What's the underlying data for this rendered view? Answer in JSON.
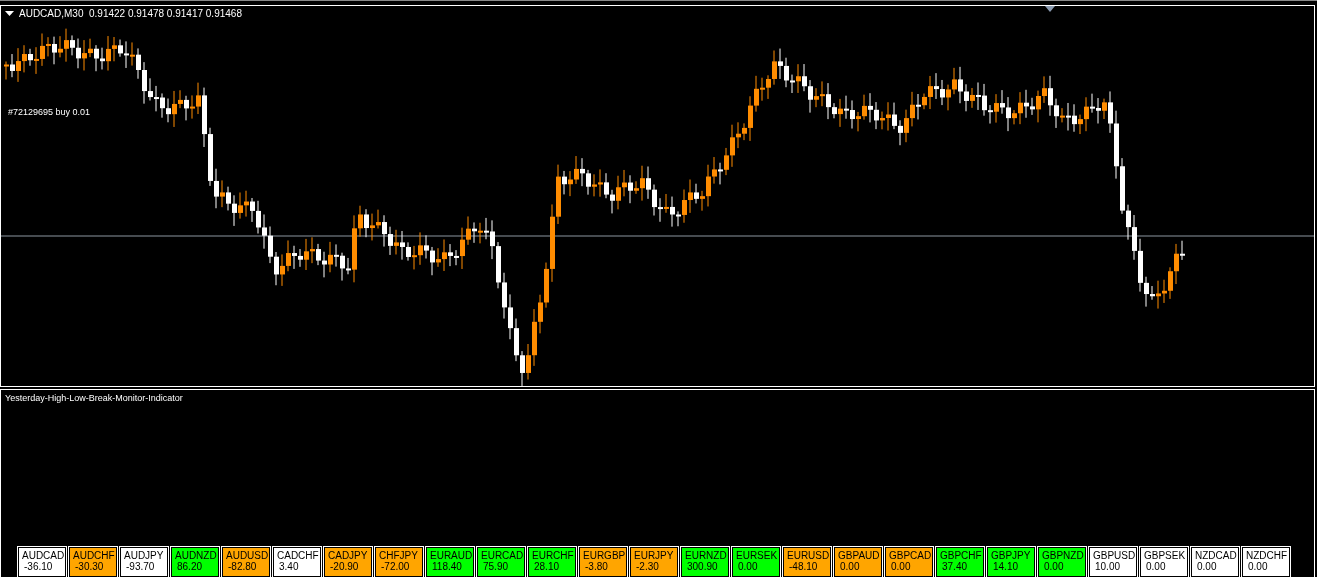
{
  "chart": {
    "header": "AUDCAD,M30  0.91422 0.91478 0.91417 0.91468",
    "order_label": "#72129695 buy 0.01"
  },
  "indicator": {
    "title": "Yesterday-High-Low-Break-Monitor-Indicator",
    "tiles": [
      {
        "symbol": "AUDCAD",
        "value": "-36.10",
        "color": "#ffffff"
      },
      {
        "symbol": "AUDCHF",
        "value": "-30.30",
        "color": "#ffa500"
      },
      {
        "symbol": "AUDJPY",
        "value": "-93.70",
        "color": "#ffffff"
      },
      {
        "symbol": "AUDNZD",
        "value": "86.20",
        "color": "#00ff00"
      },
      {
        "symbol": "AUDUSD",
        "value": "-82.80",
        "color": "#ffa500"
      },
      {
        "symbol": "CADCHF",
        "value": "3.40",
        "color": "#ffffff"
      },
      {
        "symbol": "CADJPY",
        "value": "-20.90",
        "color": "#ffa500"
      },
      {
        "symbol": "CHFJPY",
        "value": "-72.00",
        "color": "#ffa500"
      },
      {
        "symbol": "EURAUD",
        "value": "118.40",
        "color": "#00ff00"
      },
      {
        "symbol": "EURCAD",
        "value": "75.90",
        "color": "#00ff00"
      },
      {
        "symbol": "EURCHF",
        "value": "28.10",
        "color": "#00ff00"
      },
      {
        "symbol": "EURGBP",
        "value": "-3.80",
        "color": "#ffa500"
      },
      {
        "symbol": "EURJPY",
        "value": "-2.30",
        "color": "#ffa500"
      },
      {
        "symbol": "EURNZD",
        "value": "300.90",
        "color": "#00ff00"
      },
      {
        "symbol": "EURSEK",
        "value": "0.00",
        "color": "#00ff00"
      },
      {
        "symbol": "EURUSD",
        "value": "-48.10",
        "color": "#ffa500"
      },
      {
        "symbol": "GBPAUD",
        "value": "0.00",
        "color": "#ffa500"
      },
      {
        "symbol": "GBPCAD",
        "value": "0.00",
        "color": "#ffa500"
      },
      {
        "symbol": "GBPCHF",
        "value": "37.40",
        "color": "#00ff00"
      },
      {
        "symbol": "GBPJPY",
        "value": "14.10",
        "color": "#00ff00"
      },
      {
        "symbol": "GBPNZD",
        "value": "0.00",
        "color": "#00ff00"
      },
      {
        "symbol": "GBPUSD",
        "value": "10.00",
        "color": "#ffffff"
      },
      {
        "symbol": "GBPSEK",
        "value": "0.00",
        "color": "#ffffff"
      },
      {
        "symbol": "NZDCAD",
        "value": "0.00",
        "color": "#ffffff"
      },
      {
        "symbol": "NZDCHF",
        "value": "0.00",
        "color": "#ffffff"
      }
    ]
  }
}
